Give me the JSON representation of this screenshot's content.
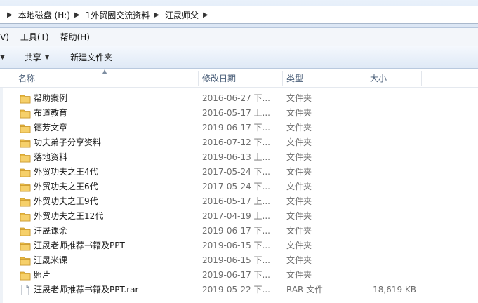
{
  "address": {
    "crumbs": [
      "本地磁盘 (H:)",
      "1外贸圈交流资料",
      "汪晟师父"
    ]
  },
  "menu": {
    "partial": "V)",
    "tools": "工具(T)",
    "help": "帮助(H)"
  },
  "toolbar": {
    "share": "共享",
    "new_folder": "新建文件夹"
  },
  "columns": {
    "name": "名称",
    "date": "修改日期",
    "type": "类型",
    "size": "大小"
  },
  "files": [
    {
      "name": "帮助案例",
      "date": "2016-06-27  下...",
      "type": "文件夹",
      "size": "",
      "icon": "folder-icon"
    },
    {
      "name": "布道教育",
      "date": "2016-05-17  上...",
      "type": "文件夹",
      "size": "",
      "icon": "folder-icon"
    },
    {
      "name": "德芳文章",
      "date": "2019-06-17  下...",
      "type": "文件夹",
      "size": "",
      "icon": "folder-icon"
    },
    {
      "name": "功夫弟子分享资料",
      "date": "2016-07-12  下...",
      "type": "文件夹",
      "size": "",
      "icon": "folder-icon"
    },
    {
      "name": "落地资料",
      "date": "2019-06-13  上...",
      "type": "文件夹",
      "size": "",
      "icon": "folder-icon"
    },
    {
      "name": "外贸功夫之王4代",
      "date": "2017-05-24  下...",
      "type": "文件夹",
      "size": "",
      "icon": "folder-icon"
    },
    {
      "name": "外贸功夫之王6代",
      "date": "2017-05-24  下...",
      "type": "文件夹",
      "size": "",
      "icon": "folder-icon"
    },
    {
      "name": "外贸功夫之王9代",
      "date": "2016-05-17  上...",
      "type": "文件夹",
      "size": "",
      "icon": "folder-icon"
    },
    {
      "name": "外贸功夫之王12代",
      "date": "2017-04-19  上...",
      "type": "文件夹",
      "size": "",
      "icon": "folder-icon"
    },
    {
      "name": "汪晟课余",
      "date": "2019-06-17  下...",
      "type": "文件夹",
      "size": "",
      "icon": "folder-icon"
    },
    {
      "name": "汪晟老师推荐书籍及PPT",
      "date": "2019-06-15  下...",
      "type": "文件夹",
      "size": "",
      "icon": "folder-icon"
    },
    {
      "name": "汪晟米课",
      "date": "2019-06-15  下...",
      "type": "文件夹",
      "size": "",
      "icon": "folder-icon"
    },
    {
      "name": "照片",
      "date": "2019-06-17  下...",
      "type": "文件夹",
      "size": "",
      "icon": "folder-icon"
    },
    {
      "name": "汪晟老师推荐书籍及PPT.rar",
      "date": "2019-05-22  下...",
      "type": "RAR 文件",
      "size": "18,619 KB",
      "icon": "file-icon"
    }
  ]
}
